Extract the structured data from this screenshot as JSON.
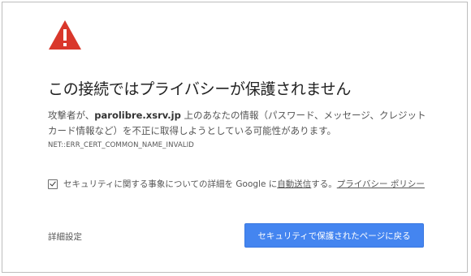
{
  "colors": {
    "warning_red": "#d9372b",
    "primary_button": "#4485f0",
    "text": "#555555"
  },
  "icon": "warning-triangle-icon",
  "title": "この接続ではプライバシーが保護されません",
  "description": {
    "prefix": "攻撃者が、",
    "host": "parolibre.xsrv.jp",
    "suffix": " 上のあなたの情報（パスワード、メッセージ、クレジットカード情報など）を不正に取得しようとしている可能性があります。"
  },
  "error_code": "NET::ERR_CERT_COMMON_NAME_INVALID",
  "opt_in": {
    "checked": true,
    "text_before": "セキュリティに関する事象についての詳細を Google に",
    "auto_send_link": "自動送信",
    "text_after": "する。",
    "privacy_link": "プライバシー ポリシー"
  },
  "advanced_label": "詳細設定",
  "back_to_safety_label": "セキュリティで保護されたページに戻る"
}
